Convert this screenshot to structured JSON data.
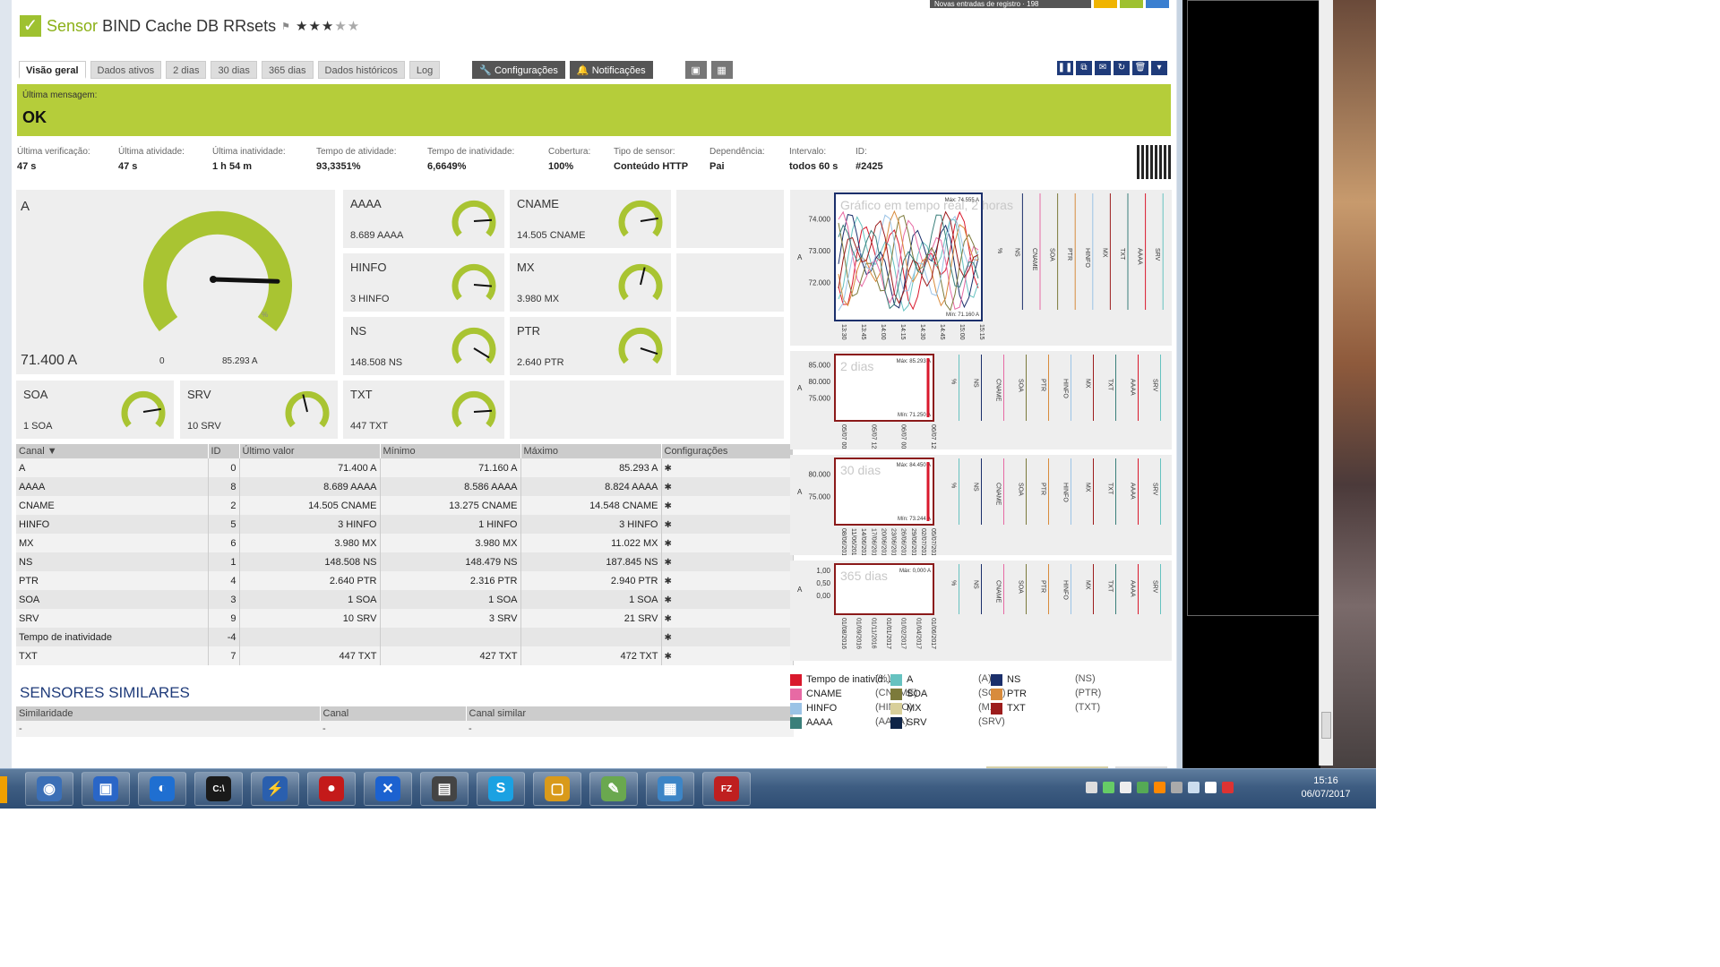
{
  "header": {
    "title_prefix": "Sensor",
    "title": "BIND Cache DB RRsets",
    "flag": "⚑",
    "stars_on": "★★★",
    "stars_off": "★★",
    "top_badge": "Novas entradas de registro · 198"
  },
  "tabs": [
    "Visão geral",
    "Dados ativos",
    "2 dias",
    "30 dias",
    "365 dias",
    "Dados históricos",
    "Log"
  ],
  "actions": {
    "config": "Configurações",
    "notifications": "Notificações"
  },
  "status": {
    "label": "Última mensagem:",
    "value": "OK",
    "color": "#b5cd3a"
  },
  "info": [
    {
      "k": "Última verificação:",
      "v": "47 s"
    },
    {
      "k": "Última atividade:",
      "v": "47 s"
    },
    {
      "k": "Última inatividade:",
      "v": "1 h 54 m"
    },
    {
      "k": "Tempo de atividade:",
      "v": "93,3351%"
    },
    {
      "k": "Tempo de inatividade:",
      "v": "6,6649%"
    },
    {
      "k": "Cobertura:",
      "v": "100%"
    },
    {
      "k": "Tipo de sensor:",
      "v": "Conteúdo HTTP"
    },
    {
      "k": "Dependência:",
      "v": "Pai"
    },
    {
      "k": "Intervalo:",
      "v": "todos 60 s"
    },
    {
      "k": "ID:",
      "v": "#2425"
    }
  ],
  "gauge_main": {
    "name": "A",
    "value": "71.400 A",
    "min": "0",
    "max": "85.293 A",
    "unit": "%",
    "level": 0.84
  },
  "gauges": [
    {
      "name": "AAAA",
      "value": "8.689 AAAA",
      "level": 0.82
    },
    {
      "name": "CNAME",
      "value": "14.505 CNAME",
      "level": 0.8
    },
    {
      "name": "HINFO",
      "value": "3 HINFO",
      "level": 0.85
    },
    {
      "name": "MX",
      "value": "3.980 MX",
      "level": 0.55
    },
    {
      "name": "NS",
      "value": "148.508 NS",
      "level": 0.95
    },
    {
      "name": "PTR",
      "value": "2.640 PTR",
      "level": 0.9
    },
    {
      "name": "SOA",
      "value": "1 SOA",
      "level": 0.8
    },
    {
      "name": "SRV",
      "value": "10 SRV",
      "level": 0.45
    },
    {
      "name": "TXT",
      "value": "447 TXT",
      "level": 0.82
    }
  ],
  "table": {
    "headers": [
      "Canal ▼",
      "ID",
      "Último valor",
      "Mínimo",
      "Máximo",
      "Configurações"
    ],
    "rows": [
      [
        "A",
        "0",
        "71.400 A",
        "71.160 A",
        "85.293 A"
      ],
      [
        "AAAA",
        "8",
        "8.689 AAAA",
        "8.586 AAAA",
        "8.824 AAAA"
      ],
      [
        "CNAME",
        "2",
        "14.505 CNAME",
        "13.275 CNAME",
        "14.548 CNAME"
      ],
      [
        "HINFO",
        "5",
        "3 HINFO",
        "1 HINFO",
        "3 HINFO"
      ],
      [
        "MX",
        "6",
        "3.980 MX",
        "3.980 MX",
        "11.022 MX"
      ],
      [
        "NS",
        "1",
        "148.508 NS",
        "148.479 NS",
        "187.845 NS"
      ],
      [
        "PTR",
        "4",
        "2.640 PTR",
        "2.316 PTR",
        "2.940 PTR"
      ],
      [
        "SOA",
        "3",
        "1 SOA",
        "1 SOA",
        "1 SOA"
      ],
      [
        "SRV",
        "9",
        "10 SRV",
        "3 SRV",
        "21 SRV"
      ],
      [
        "Tempo de inatividade",
        "-4",
        "",
        "",
        ""
      ],
      [
        "TXT",
        "7",
        "447 TXT",
        "427 TXT",
        "472 TXT"
      ]
    ],
    "gear": "✱"
  },
  "similar": {
    "title": "SENSORES SIMILARES",
    "headers": [
      "Similaridade",
      "Canal",
      "Canal similar"
    ],
    "row": [
      "-",
      "-",
      "-"
    ]
  },
  "charts": [
    {
      "label": "Gráfico em tempo real, 2 horas",
      "ymax": "Máx: 74.555 A",
      "ymin": "Mín: 71.160 A",
      "yticks": [
        "74.000",
        "73.000",
        "72.000"
      ],
      "xticks": [
        "13:30",
        "13:45",
        "14:00",
        "14:15",
        "14:30",
        "14:45",
        "15:00",
        "15:15"
      ]
    },
    {
      "label": "2 dias",
      "ymax": "Máx: 85.293 A",
      "ymin": "Mín: 71.250 A",
      "yticks": [
        "85.000",
        "80.000",
        "75.000"
      ],
      "xticks": [
        "05/07 00:00",
        "05/07 12:00",
        "06/07 00:00",
        "06/07 12:00"
      ]
    },
    {
      "label": "30 dias",
      "ymax": "Máx: 84.450 A",
      "ymin": "Mín: 73.244 A",
      "yticks": [
        "80.000",
        "75.000"
      ],
      "xticks": [
        "08/06/2017",
        "11/06/2017",
        "14/06/2017",
        "17/06/2017",
        "20/06/2017",
        "23/06/2017",
        "26/06/2017",
        "29/06/2017",
        "02/07/2017",
        "05/07/2017"
      ]
    },
    {
      "label": "365 dias",
      "ymax": "Máx: 0,000 A",
      "ymin": "",
      "yticks": [
        "1,00",
        "0,50",
        "0,00"
      ],
      "xticks": [
        "01/08/2016",
        "01/09/2016",
        "01/11/2016",
        "01/01/2017",
        "01/02/2017",
        "01/04/2017",
        "01/06/2017"
      ]
    }
  ],
  "chart_channels": [
    "%",
    "NS",
    "CNAME",
    "SOA",
    "PTR",
    "HINFO",
    "MX",
    "TXT",
    "AAAA",
    "SRV"
  ],
  "chart_axis": "A",
  "legend": [
    {
      "name": "Tempo de inativid...",
      "unit": "(%)",
      "color": "#d9182c"
    },
    {
      "name": "A",
      "unit": "(A)",
      "color": "#66c2c0"
    },
    {
      "name": "NS",
      "unit": "(NS)",
      "color": "#1b2f6b"
    },
    {
      "name": "CNAME",
      "unit": "(CNAME)",
      "color": "#e76aa4"
    },
    {
      "name": "SOA",
      "unit": "(SOA)",
      "color": "#7c7a3b"
    },
    {
      "name": "PTR",
      "unit": "(PTR)",
      "color": "#d88b3c"
    },
    {
      "name": "HINFO",
      "unit": "(HINFO)",
      "color": "#9bc3e6"
    },
    {
      "name": "MX",
      "unit": "(MX)",
      "color": "#d8cf9a"
    },
    {
      "name": "TXT",
      "unit": "(TXT)",
      "color": "#9c1c1c"
    },
    {
      "name": "AAAA",
      "unit": "(AAAA)",
      "color": "#3a7f7a"
    },
    {
      "name": "SRV",
      "unit": "(SRV)",
      "color": "#0e2447"
    }
  ],
  "taskbar": {
    "icons": [
      {
        "name": "network-icon",
        "color": "#3b6fb6",
        "glyph": "◉"
      },
      {
        "name": "remote-desktop-icon",
        "color": "#2a66c7",
        "glyph": "▣"
      },
      {
        "name": "app-circle-icon",
        "color": "#1f6fd1",
        "glyph": "◐"
      },
      {
        "name": "terminal-icon",
        "color": "#1a1a1a",
        "glyph": "C:\\"
      },
      {
        "name": "network-tool-icon",
        "color": "#2a5fae",
        "glyph": "⚡"
      },
      {
        "name": "red-app-icon",
        "color": "#c41a1a",
        "glyph": "●"
      },
      {
        "name": "xmanager-icon",
        "color": "#1c62d0",
        "glyph": "✕"
      },
      {
        "name": "usb-device-icon",
        "color": "#444444",
        "glyph": "▤"
      },
      {
        "name": "skype-icon",
        "color": "#1ba1e2",
        "glyph": "S"
      },
      {
        "name": "folder-app-icon",
        "color": "#d99a1a",
        "glyph": "▢"
      },
      {
        "name": "notepad-icon",
        "color": "#6aa84f",
        "glyph": "✎"
      },
      {
        "name": "remote-session-icon",
        "color": "#3d85c6",
        "glyph": "▦"
      },
      {
        "name": "filezilla-icon",
        "color": "#bf1f1f",
        "glyph": "FZ"
      }
    ],
    "time": "15:16",
    "date": "06/07/2017"
  }
}
